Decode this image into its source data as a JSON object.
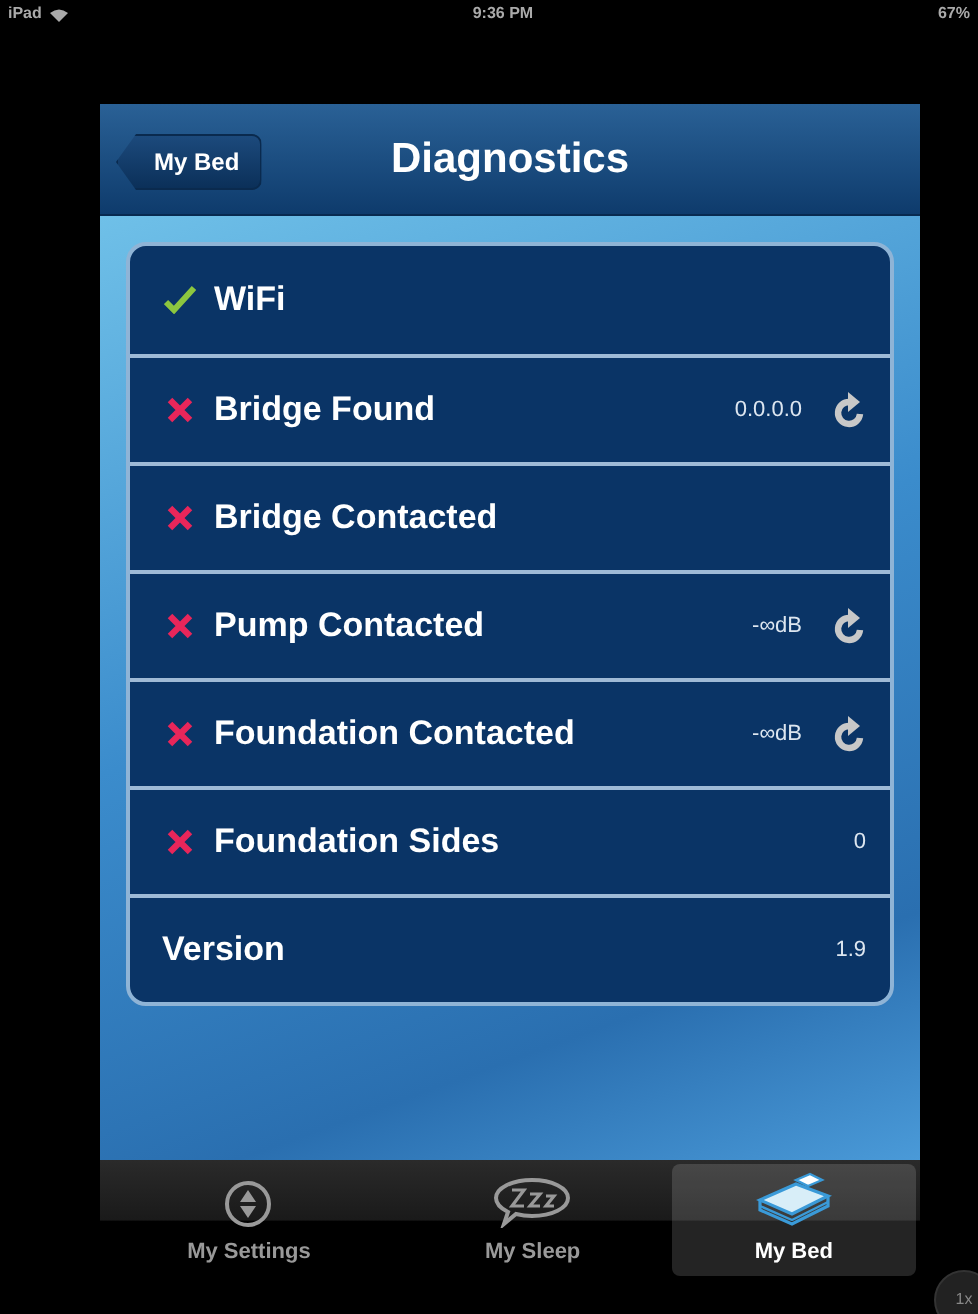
{
  "status_bar": {
    "device": "iPad",
    "time": "9:36 PM",
    "battery": "67%"
  },
  "nav_bar": {
    "back": "My Bed",
    "title": "Diagnostics"
  },
  "rows": [
    {
      "kind": "ok",
      "label": "WiFi",
      "refresh": false
    },
    {
      "kind": "fail",
      "label": "Bridge Found",
      "value": "0.0.0.0",
      "refresh": true
    },
    {
      "kind": "fail",
      "label": "Bridge Contacted",
      "refresh": false
    },
    {
      "kind": "fail",
      "label": "Pump Contacted",
      "value": "-∞dB",
      "refresh": true
    },
    {
      "kind": "fail",
      "label": "Foundation Contacted",
      "value": "-∞dB",
      "refresh": true
    },
    {
      "kind": "fail",
      "label": "Foundation Sides",
      "value": "0",
      "refresh": false
    },
    {
      "kind": "info",
      "label": "Version",
      "value": "1.9",
      "refresh": false
    }
  ],
  "tab_bar": [
    {
      "label": "My Settings",
      "selected": false
    },
    {
      "label": "My Sleep",
      "selected": false
    },
    {
      "label": "My Bed",
      "selected": true
    }
  ],
  "zoom_button": "1x"
}
